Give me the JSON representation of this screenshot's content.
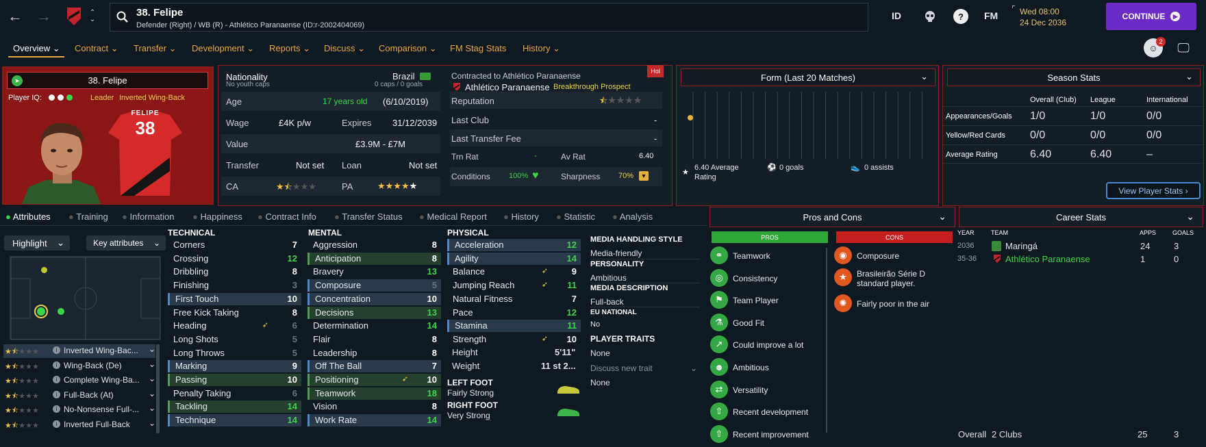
{
  "top": {
    "player_name": "38. Felipe",
    "player_sub": "Defender (Right) / WB (R) - Athlético Paranaense (ID:r-2002404069)",
    "id_label": "ID",
    "fm_label": "FM",
    "date_line1": "Wed 08:00",
    "date_line2": "24 Dec 2036",
    "continue_label": "CONTINUE",
    "notif_count": "2"
  },
  "nav": {
    "items": [
      {
        "label": "Overview ⌄"
      },
      {
        "label": "Contract ⌄"
      },
      {
        "label": "Transfer ⌄"
      },
      {
        "label": "Development ⌄"
      },
      {
        "label": "Reports ⌄"
      },
      {
        "label": "Discuss ⌄"
      },
      {
        "label": "Comparison ⌄"
      },
      {
        "label": "FM Stag Stats"
      },
      {
        "label": "History ⌄"
      }
    ]
  },
  "card": {
    "name": "38. Felipe",
    "iq_label": "Player IQ:",
    "leader": "Leader",
    "role": "Inverted Wing-Back",
    "shirt_name": "FELIPE",
    "shirt_number": "38"
  },
  "info": {
    "nationality_label": "Nationality",
    "nationality": "Brazil",
    "caps_left": "No youth caps",
    "caps_right": "0 caps / 0 goals",
    "age_label": "Age",
    "age": "17 years old",
    "dob": "(6/10/2019)",
    "wage_label": "Wage",
    "wage": "£4K p/w",
    "expires_label": "Expires",
    "expires": "31/12/2039",
    "value_label": "Value",
    "value": "£3.9M - £7M",
    "transfer_label": "Transfer",
    "transfer": "Not set",
    "loan_label": "Loan",
    "loan": "Not set",
    "ca_label": "CA",
    "pa_label": "PA",
    "contracted": "Contracted to Athlético Paranaense",
    "hol": "Hol",
    "club": "Athlético Paranaense",
    "prospect": "Breakthrough Prospect",
    "reputation_label": "Reputation",
    "lastclub_label": "Last Club",
    "lastclub": "-",
    "ltf_label": "Last Transfer Fee",
    "ltf": "-",
    "trnrat_label": "Trn Rat",
    "trnrat": "-",
    "avrat_label": "Av Rat",
    "avrat": "6.40",
    "conditions_label": "Conditions",
    "conditions": "100%",
    "sharpness_label": "Sharpness",
    "sharpness": "70%"
  },
  "form": {
    "title": "Form (Last 20 Matches)",
    "avg": "6.40 Average Rating",
    "goals": "0 goals",
    "assists": "0 assists"
  },
  "season": {
    "title": "Season Stats",
    "cols": [
      "Overall (Club)",
      "League",
      "International"
    ],
    "rows": [
      {
        "label": "Appearances/Goals",
        "v": [
          "1/0",
          "1/0",
          "0/0"
        ]
      },
      {
        "label": "Yellow/Red Cards",
        "v": [
          "0/0",
          "0/0",
          "0/0"
        ]
      },
      {
        "label": "Average Rating",
        "v": [
          "6.40",
          "6.40",
          "–"
        ]
      }
    ],
    "button": "View Player Stats ›"
  },
  "tabs2": [
    "Attributes",
    "Training",
    "Information",
    "Happiness",
    "Contract Info",
    "Transfer Status",
    "Medical Report",
    "History",
    "Statistic",
    "Analysis"
  ],
  "controls": {
    "highlight": "Highlight",
    "key": "Key attributes"
  },
  "roles": [
    "Inverted Wing-Bac...",
    "Wing-Back (De)",
    "Complete Wing-Ba...",
    "Full-Back (At)",
    "No-Nonsense Full-...",
    "Inverted Full-Back"
  ],
  "technical": {
    "title": "TECHNICAL",
    "items": [
      [
        "Corners",
        "7"
      ],
      [
        "Crossing",
        "12"
      ],
      [
        "Dribbling",
        "8"
      ],
      [
        "Finishing",
        "3"
      ],
      [
        "First Touch",
        "10"
      ],
      [
        "Free Kick Taking",
        "8"
      ],
      [
        "Heading",
        "6"
      ],
      [
        "Long Shots",
        "5"
      ],
      [
        "Long Throws",
        "5"
      ],
      [
        "Marking",
        "9"
      ],
      [
        "Passing",
        "10"
      ],
      [
        "Penalty Taking",
        "6"
      ],
      [
        "Tackling",
        "14"
      ],
      [
        "Technique",
        "14"
      ]
    ]
  },
  "mental": {
    "title": "MENTAL",
    "items": [
      [
        "Aggression",
        "8"
      ],
      [
        "Anticipation",
        "8"
      ],
      [
        "Bravery",
        "13"
      ],
      [
        "Composure",
        "5"
      ],
      [
        "Concentration",
        "10"
      ],
      [
        "Decisions",
        "13"
      ],
      [
        "Determination",
        "14"
      ],
      [
        "Flair",
        "8"
      ],
      [
        "Leadership",
        "8"
      ],
      [
        "Off The Ball",
        "7"
      ],
      [
        "Positioning",
        "10"
      ],
      [
        "Teamwork",
        "18"
      ],
      [
        "Vision",
        "8"
      ],
      [
        "Work Rate",
        "14"
      ]
    ]
  },
  "physical": {
    "title": "PHYSICAL",
    "items": [
      [
        "Acceleration",
        "12"
      ],
      [
        "Agility",
        "14"
      ],
      [
        "Balance",
        "9"
      ],
      [
        "Jumping Reach",
        "11"
      ],
      [
        "Natural Fitness",
        "7"
      ],
      [
        "Pace",
        "12"
      ],
      [
        "Stamina",
        "11"
      ],
      [
        "Strength",
        "10"
      ]
    ],
    "height_label": "Height",
    "height": "5'11\"",
    "weight_label": "Weight",
    "weight": "11 st 2...",
    "left_foot_label": "LEFT FOOT",
    "left_foot": "Fairly Strong",
    "right_foot_label": "RIGHT FOOT",
    "right_foot": "Very Strong"
  },
  "media": {
    "mhs_title": "MEDIA HANDLING STYLE",
    "mhs": "Media-friendly",
    "pers_title": "PERSONALITY",
    "pers": "Ambitious",
    "md_title": "MEDIA DESCRIPTION",
    "md": "Full-back",
    "eu_title": "EU NATIONAL",
    "eu": "No",
    "traits_title": "PLAYER TRAITS",
    "traits": "None",
    "discuss": "Discuss new trait",
    "none2": "None"
  },
  "proscons": {
    "title": "Pros and Cons",
    "pros_label": "PROS",
    "cons_label": "CONS",
    "pros": [
      "Teamwork",
      "Consistency",
      "Team Player",
      "Good Fit",
      "Could improve a lot",
      "Ambitious",
      "Versatility",
      "Recent development",
      "Recent improvement"
    ],
    "cons": [
      "Composure",
      "Brasileirão Série D standard player.",
      "Fairly poor in the air"
    ]
  },
  "career": {
    "title": "Career Stats",
    "cols": [
      "YEAR",
      "TEAM",
      "APPS",
      "GOALS"
    ],
    "rows": [
      {
        "year": "2036",
        "team": "Maringá",
        "apps": "24",
        "goals": "3"
      },
      {
        "year": "35-36",
        "team": "Athlético Paranaense",
        "apps": "1",
        "goals": "0"
      }
    ],
    "overall_label": "Overall",
    "overall_clubs": "2 Clubs",
    "overall_apps": "25",
    "overall_goals": "3"
  }
}
